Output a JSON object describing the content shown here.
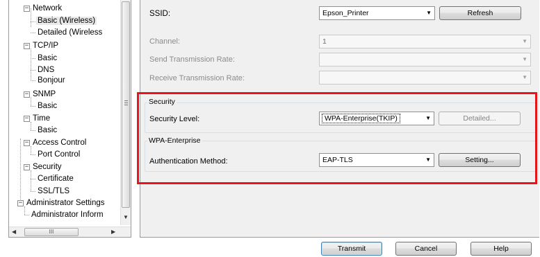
{
  "tree": {
    "items": [
      {
        "label": "Network",
        "expander": "−"
      },
      {
        "label": "Basic (Wireless)"
      },
      {
        "label": "Detailed (Wireless"
      },
      {
        "label": "TCP/IP",
        "expander": "−"
      },
      {
        "label": "Basic"
      },
      {
        "label": "DNS"
      },
      {
        "label": "Bonjour"
      },
      {
        "label": "SNMP",
        "expander": "−"
      },
      {
        "label": "Basic"
      },
      {
        "label": "Time",
        "expander": "−"
      },
      {
        "label": "Basic"
      },
      {
        "label": "Access Control",
        "expander": "−"
      },
      {
        "label": "Port Control"
      },
      {
        "label": "Security",
        "expander": "−"
      },
      {
        "label": "Certificate"
      },
      {
        "label": "SSL/TLS"
      },
      {
        "label": "Administrator Settings",
        "expander": "−"
      },
      {
        "label": "Administrator Inform"
      }
    ],
    "hscroll_grip": "III"
  },
  "ssid": {
    "label": "SSID:",
    "value": "Epson_Printer",
    "refresh_label": "Refresh"
  },
  "channel": {
    "label": "Channel:",
    "value": "1"
  },
  "send_rate": {
    "label": "Send Transmission Rate:",
    "value": ""
  },
  "receive_rate": {
    "label": "Receive Transmission Rate:",
    "value": ""
  },
  "security": {
    "group_title": "Security",
    "level_label": "Security Level:",
    "level_value": "WPA-Enterprise(TKIP)",
    "detailed_label": "Detailed..."
  },
  "wpa": {
    "group_title": "WPA-Enterprise",
    "auth_label": "Authentication Method:",
    "auth_value": "EAP-TLS",
    "setting_label": "Setting..."
  },
  "footer": {
    "transmit_label": "Transmit",
    "cancel_label": "Cancel",
    "help_label": "Help"
  },
  "colors": {
    "highlight": "#e8141c",
    "panel_bg": "#f0f0f0"
  }
}
